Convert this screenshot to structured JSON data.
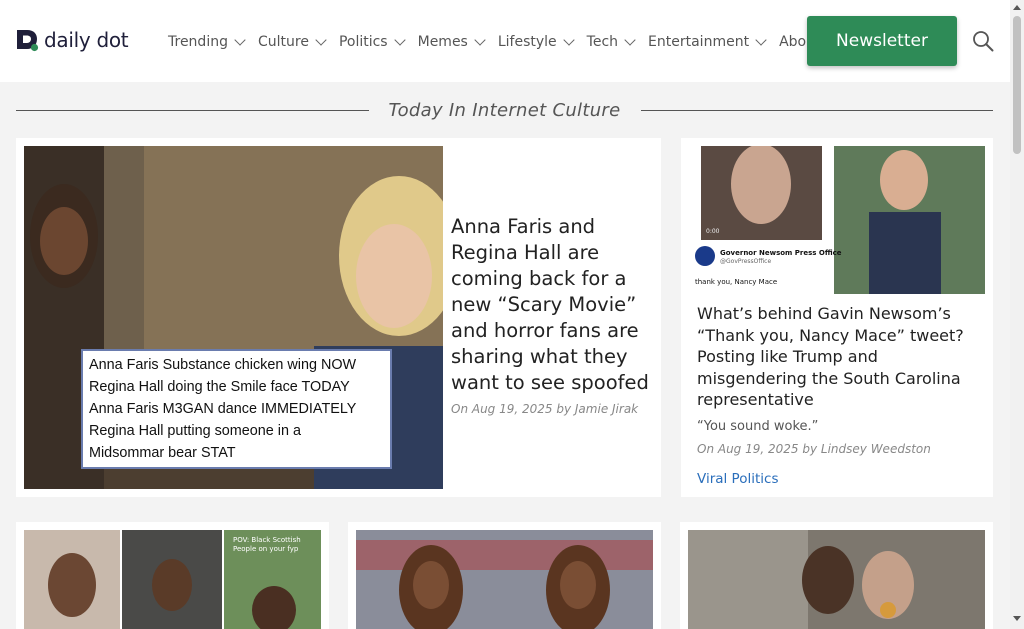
{
  "site": {
    "name": "daily dot"
  },
  "nav": {
    "items": [
      {
        "label": "Trending"
      },
      {
        "label": "Culture"
      },
      {
        "label": "Politics"
      },
      {
        "label": "Memes"
      },
      {
        "label": "Lifestyle"
      },
      {
        "label": "Tech"
      },
      {
        "label": "Entertainment"
      },
      {
        "label": "Abou"
      }
    ],
    "newsletter_label": "Newsletter"
  },
  "section": {
    "title": "Today In Internet Culture"
  },
  "feature": {
    "image_caption_lines": [
      "Anna Faris Substance chicken wing NOW",
      "Regina Hall doing the Smile face TODAY",
      "Anna Faris M3GAN dance IMMEDIATELY",
      "Regina Hall putting someone in a",
      "Midsommar bear STAT"
    ],
    "title": "Anna Faris and Regina Hall are coming back for a new “Scary Movie” and horror fans are sharing what they want to see spoofed",
    "byline": "On Aug 19, 2025 by Jamie Jirak"
  },
  "side": {
    "image_text": {
      "timestamp": "0:00",
      "account_name": "Governor Newsom Press Office",
      "account_handle": "@GovPressOffice",
      "tweet": "thank you, Nancy Mace"
    },
    "title": "What’s behind Gavin Newsom’s “Thank you, Nancy Mace” tweet? Posting like Trump and misgendering the South Carolina representative",
    "quote": "“You sound woke.”",
    "byline": "On Aug 19, 2025 by Lindsey Weedston",
    "tag": "Viral Politics"
  },
  "row_cards": [
    {
      "image_text": "POV: Black Scottish People on your fyp"
    },
    {
      "image_text": ""
    },
    {
      "image_text": ""
    }
  ],
  "colors": {
    "brand_green": "#2e8b57",
    "link_blue": "#2a6ebb",
    "logo_navy": "#1f1f3a"
  }
}
